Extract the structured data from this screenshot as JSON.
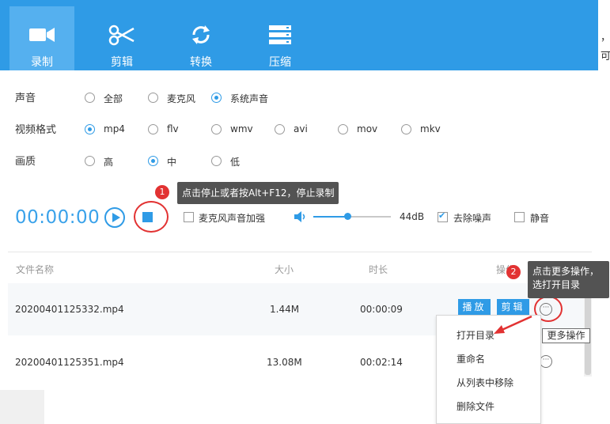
{
  "tabs": [
    {
      "label": "录制",
      "icon": "video-camera-icon"
    },
    {
      "label": "剪辑",
      "icon": "scissors-icon"
    },
    {
      "label": "转换",
      "icon": "convert-icon"
    },
    {
      "label": "压缩",
      "icon": "compress-icon"
    }
  ],
  "right_strip": {
    "line1": "，",
    "line2": "可"
  },
  "audio": {
    "label": "声音",
    "options": [
      "全部",
      "麦克风",
      "系统声音"
    ],
    "selected": "系统声音"
  },
  "format": {
    "label": "视频格式",
    "options": [
      "mp4",
      "flv",
      "wmv",
      "avi",
      "mov",
      "mkv"
    ],
    "selected": "mp4"
  },
  "quality": {
    "label": "画质",
    "options": [
      "高",
      "中",
      "低"
    ],
    "selected": "中"
  },
  "controls": {
    "timer": "00:00:00",
    "mic_boost_label": "麦克风声音加强",
    "mic_boost_checked": false,
    "volume_value": "44dB",
    "volume_level": 0.44,
    "denoise_label": "去除噪声",
    "denoise_checked": true,
    "mute_label": "静音",
    "mute_checked": false
  },
  "table": {
    "headers": {
      "name": "文件名称",
      "size": "大小",
      "duration": "时长",
      "actions": "操作"
    },
    "rows": [
      {
        "name": "20200401125332.mp4",
        "size": "1.44M",
        "duration": "00:00:09"
      },
      {
        "name": "20200401125351.mp4",
        "size": "13.08M",
        "duration": "00:02:14"
      }
    ],
    "play_label": "播放",
    "edit_label": "剪辑"
  },
  "tip1": {
    "number": "1",
    "text": "点击停止或者按Alt+F12，停止录制"
  },
  "tip2": {
    "number": "2",
    "line1": "点击更多操作，",
    "line2": "选打开目录"
  },
  "context_menu": [
    "打开目录",
    "重命名",
    "从列表中移除",
    "删除文件"
  ],
  "more_tooltip": "更多操作",
  "colors": {
    "accent": "#2f9be6",
    "annotation_red": "#e23232"
  }
}
